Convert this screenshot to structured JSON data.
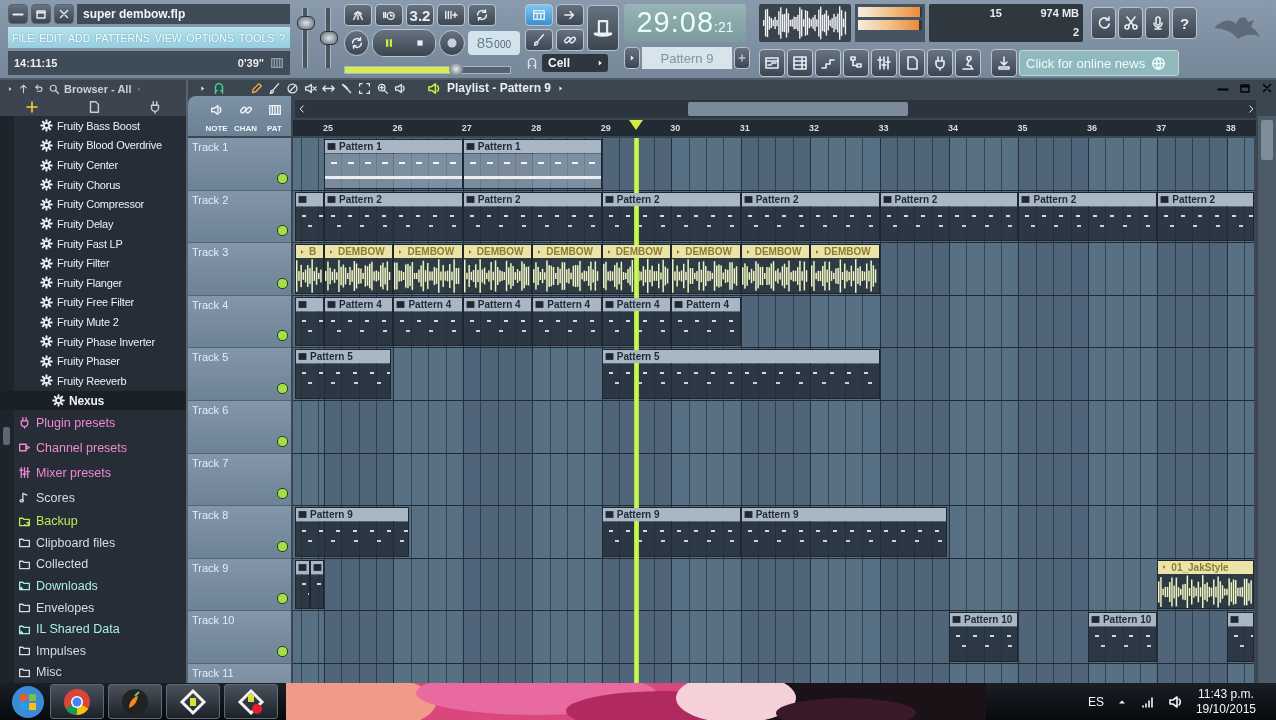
{
  "window": {
    "title": "super dembow.flp"
  },
  "menu": [
    "FILE",
    "EDIT",
    "ADD",
    "PATTERNS",
    "VIEW",
    "OPTIONS",
    "TOOLS",
    "?"
  ],
  "hint_bar": {
    "clock": "14:11:15",
    "duration": "0'39\""
  },
  "master": {
    "volume": {
      "level": 0.82
    },
    "pitch": {
      "level": 0.5
    }
  },
  "transport": {
    "playing": true,
    "typing_button": "3.2",
    "tempo": "85",
    "tempo_fraction": "000",
    "position": {
      "level": 0.67
    }
  },
  "playlist_button": {
    "on": true
  },
  "snap": {
    "value": "Cell"
  },
  "song_time": {
    "main": "29:08",
    "ticks": ":21"
  },
  "pattern_selector": {
    "value": "Pattern 9"
  },
  "output_meter": {
    "left": {
      "level": 0.97
    },
    "right": {
      "level": 0.95
    }
  },
  "cpu_panel": {
    "reading_1": "15",
    "memory": "974 MB",
    "reading_2": "2"
  },
  "help_button": "?",
  "news": {
    "label": "Click for online news"
  },
  "browser": {
    "title": "Browser - All",
    "items": [
      {
        "label": "Fruity Bass Boost",
        "kind": "plugin",
        "selected": false
      },
      {
        "label": "Fruity Blood Overdrive",
        "kind": "plugin",
        "selected": false
      },
      {
        "label": "Fruity Center",
        "kind": "plugin",
        "selected": false
      },
      {
        "label": "Fruity Chorus",
        "kind": "plugin",
        "selected": false
      },
      {
        "label": "Fruity Compressor",
        "kind": "plugin",
        "selected": false
      },
      {
        "label": "Fruity Delay",
        "kind": "plugin",
        "selected": false
      },
      {
        "label": "Fruity Fast LP",
        "kind": "plugin",
        "selected": false
      },
      {
        "label": "Fruity Filter",
        "kind": "plugin",
        "selected": false
      },
      {
        "label": "Fruity Flanger",
        "kind": "plugin",
        "selected": false
      },
      {
        "label": "Fruity Free Filter",
        "kind": "plugin",
        "selected": false
      },
      {
        "label": "Fruity Mute 2",
        "kind": "plugin",
        "selected": false
      },
      {
        "label": "Fruity Phase Inverter",
        "kind": "plugin",
        "selected": false
      },
      {
        "label": "Fruity Phaser",
        "kind": "plugin",
        "selected": false
      },
      {
        "label": "Fruity Reeverb",
        "kind": "plugin",
        "selected": false
      },
      {
        "label": "Nexus",
        "kind": "plugin",
        "selected": true
      },
      {
        "label": "Plugin presets",
        "kind": "plugin_preset",
        "selected": false,
        "color": "#f08ad0"
      },
      {
        "label": "Channel presets",
        "kind": "channel_preset",
        "selected": false,
        "color": "#f08ad0"
      },
      {
        "label": "Mixer presets",
        "kind": "mixer_preset",
        "selected": false,
        "color": "#f08ad0"
      },
      {
        "label": "Scores",
        "kind": "score",
        "selected": false,
        "color": "#d8dce6"
      },
      {
        "label": "Backup",
        "kind": "backup",
        "selected": false,
        "color": "#b8ec58"
      },
      {
        "label": "Clipboard files",
        "kind": "folder",
        "selected": false,
        "color": "#d8dce6"
      },
      {
        "label": "Collected",
        "kind": "folder",
        "selected": false,
        "color": "#d8dce6"
      },
      {
        "label": "Downloads",
        "kind": "special_folder",
        "selected": false,
        "color": "#a8eee0"
      },
      {
        "label": "Envelopes",
        "kind": "folder",
        "selected": false,
        "color": "#d8dce6"
      },
      {
        "label": "IL Shared Data",
        "kind": "special_folder",
        "selected": false,
        "color": "#a8eee0"
      },
      {
        "label": "Impulses",
        "kind": "folder",
        "selected": false,
        "color": "#d8dce6"
      },
      {
        "label": "Misc",
        "kind": "folder",
        "selected": false,
        "color": "#d8dce6"
      }
    ]
  },
  "playlist": {
    "title": "Playlist - Pattern 9",
    "tool_labels": [
      "NOTE",
      "CHAN",
      "PAT"
    ],
    "ruler": [
      "25",
      "26",
      "27",
      "28",
      "29",
      "30",
      "31",
      "32",
      "33",
      "34",
      "35",
      "36",
      "37",
      "38"
    ],
    "playhead": {
      "level": 0.357
    },
    "tracks": [
      {
        "name": "Track 1",
        "on": true,
        "clips": [
          {
            "kind": "pattern",
            "label": "Pattern 1",
            "selected": true
          },
          {
            "kind": "pattern",
            "label": "Pattern 1",
            "selected": true
          }
        ]
      },
      {
        "name": "Track 2",
        "on": true,
        "clips": [
          {
            "kind": "pattern",
            "selected": false
          },
          {
            "kind": "pattern",
            "label": "Pattern 2",
            "selected": false
          },
          {
            "kind": "pattern",
            "label": "Pattern 2",
            "selected": false
          },
          {
            "kind": "pattern",
            "label": "Pattern 2",
            "selected": false
          },
          {
            "kind": "pattern",
            "label": "Pattern 2",
            "selected": false
          },
          {
            "kind": "pattern",
            "label": "Pattern 2",
            "selected": false
          },
          {
            "kind": "pattern",
            "label": "Pattern 2",
            "selected": false
          },
          {
            "kind": "pattern",
            "label": "Pattern 2",
            "selected": false
          }
        ]
      },
      {
        "name": "Track 3",
        "on": true,
        "clips": [
          {
            "kind": "audio",
            "label": "B"
          },
          {
            "kind": "audio",
            "label": "DEMBOW"
          },
          {
            "kind": "audio",
            "label": "DEMBOW"
          },
          {
            "kind": "audio",
            "label": "DEMBOW"
          },
          {
            "kind": "audio",
            "label": "DEMBOW"
          },
          {
            "kind": "audio",
            "label": "DEMBOW"
          },
          {
            "kind": "audio",
            "label": "DEMBOW"
          },
          {
            "kind": "audio",
            "label": "DEMBOW"
          },
          {
            "kind": "audio",
            "label": "DEMBOW"
          }
        ]
      },
      {
        "name": "Track 4",
        "on": true,
        "clips": [
          {
            "kind": "pattern",
            "selected": false
          },
          {
            "kind": "pattern",
            "label": "Pattern 4",
            "selected": false
          },
          {
            "kind": "pattern",
            "label": "Pattern 4",
            "selected": false
          },
          {
            "kind": "pattern",
            "label": "Pattern 4",
            "selected": false
          },
          {
            "kind": "pattern",
            "label": "Pattern 4",
            "selected": false
          },
          {
            "kind": "pattern",
            "label": "Pattern 4",
            "selected": false
          },
          {
            "kind": "pattern",
            "label": "Pattern 4",
            "selected": false
          }
        ]
      },
      {
        "name": "Track 5",
        "on": true,
        "clips": [
          {
            "kind": "pattern",
            "label": "Pattern 5",
            "selected": false
          },
          {
            "kind": "pattern",
            "label": "Pattern 5",
            "selected": false
          }
        ]
      },
      {
        "name": "Track 6",
        "on": true
      },
      {
        "name": "Track 7",
        "on": true
      },
      {
        "name": "Track 8",
        "on": true,
        "clips": [
          {
            "kind": "pattern",
            "label": "Pattern 9",
            "selected": false
          },
          {
            "kind": "pattern",
            "label": "Pattern 9",
            "selected": false
          },
          {
            "kind": "pattern",
            "label": "Pattern 9",
            "selected": false
          }
        ]
      },
      {
        "name": "Track 9",
        "on": true,
        "clips": [
          {
            "kind": "pattern",
            "selected": false
          },
          {
            "kind": "pattern",
            "selected": false
          },
          {
            "kind": "audio",
            "label": "01_JakStyle"
          }
        ]
      },
      {
        "name": "Track 10",
        "on": true,
        "clips": [
          {
            "kind": "pattern",
            "label": "Pattern 10",
            "selected": false
          },
          {
            "kind": "pattern",
            "label": "Pattern 10",
            "selected": false
          },
          {
            "kind": "pattern",
            "selected": false
          }
        ]
      },
      {
        "name": "Track 11"
      }
    ]
  },
  "taskbar": {
    "language": "ES",
    "time": "11:43 p.m.",
    "date": "19/10/2015"
  }
}
